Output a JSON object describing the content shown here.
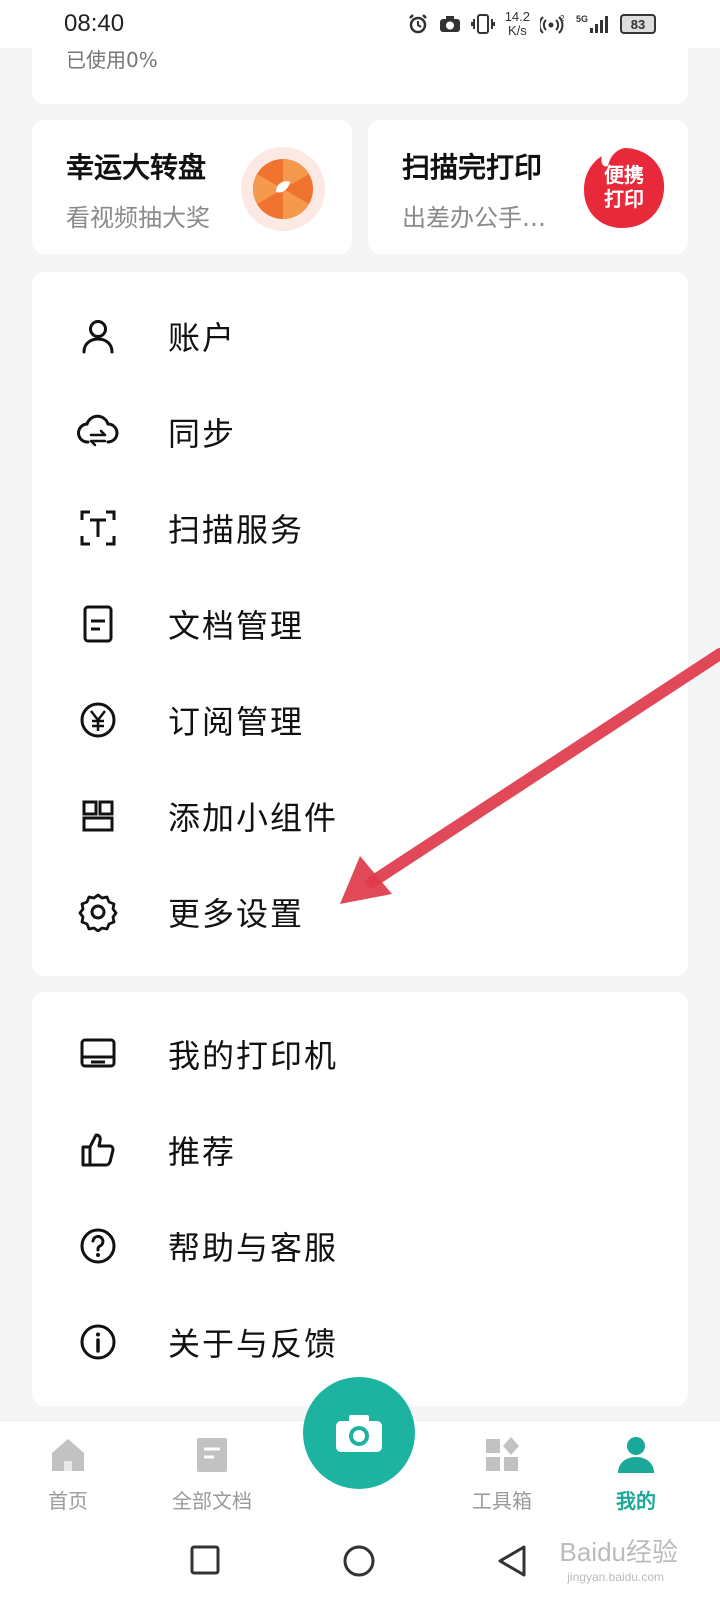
{
  "status_bar": {
    "time": "08:40",
    "speed_value": "14.2",
    "speed_unit": "K/s",
    "network": "5G",
    "battery": "83",
    "signal_sub": "2"
  },
  "storage": {
    "usage_text": "已使用0%"
  },
  "promos": [
    {
      "title": "幸运大转盘",
      "subtitle": "看视频抽大奖",
      "icon": "lucky-wheel-icon"
    },
    {
      "title": "扫描完打印",
      "subtitle": "出差办公手…",
      "icon": "portable-print-badge",
      "badge_line1": "便携",
      "badge_line2": "打印"
    }
  ],
  "menu_main": [
    {
      "label": "账户",
      "icon": "person-icon"
    },
    {
      "label": "同步",
      "icon": "cloud-sync-icon"
    },
    {
      "label": "扫描服务",
      "icon": "text-scan-icon"
    },
    {
      "label": "文档管理",
      "icon": "document-icon"
    },
    {
      "label": "订阅管理",
      "icon": "yen-icon"
    },
    {
      "label": "添加小组件",
      "icon": "widget-icon"
    },
    {
      "label": "更多设置",
      "icon": "gear-icon"
    }
  ],
  "menu_secondary": [
    {
      "label": "我的打印机",
      "icon": "printer-icon"
    },
    {
      "label": "推荐",
      "icon": "thumbs-up-icon"
    },
    {
      "label": "帮助与客服",
      "icon": "help-icon"
    },
    {
      "label": "关于与反馈",
      "icon": "info-icon"
    }
  ],
  "bottom_nav": [
    {
      "label": "首页",
      "icon": "home-icon",
      "active": false
    },
    {
      "label": "全部文档",
      "icon": "documents-icon",
      "active": false
    },
    {
      "label": "工具箱",
      "icon": "toolbox-icon",
      "active": false
    },
    {
      "label": "我的",
      "icon": "profile-icon",
      "active": true
    }
  ],
  "camera_button": {
    "icon": "camera-icon"
  },
  "colors": {
    "accent": "#1db3a1",
    "active_tab": "#1aa899",
    "annotation_arrow": "#e03a4a"
  },
  "watermark": {
    "brand": "Baidu经验",
    "domain": "jingyan.baidu.com"
  }
}
